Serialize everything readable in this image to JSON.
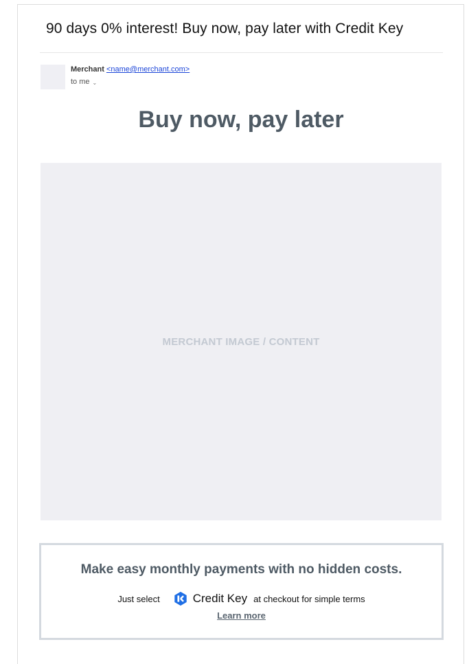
{
  "email": {
    "subject": "90 days 0% interest! Buy now, pay later with Credit Key",
    "sender_name": "Merchant",
    "sender_email": "<name@merchant.com>",
    "recipient": "to me",
    "chevron_icon": "chevron-down-icon"
  },
  "content": {
    "headline": "Buy now, pay later",
    "image_placeholder": "MERCHANT IMAGE / CONTENT"
  },
  "promo": {
    "title": "Make easy monthly payments with no hidden costs.",
    "prefix": "Just select",
    "brand": "Credit Key",
    "brand_icon": "credit-key-logo-icon",
    "suffix": "at checkout for simple terms",
    "link": "Learn more"
  },
  "colors": {
    "headline": "#4e5a64",
    "link": "#1a44d8",
    "brand": "#1f6fe5",
    "placeholder_bg": "#efeff3"
  }
}
